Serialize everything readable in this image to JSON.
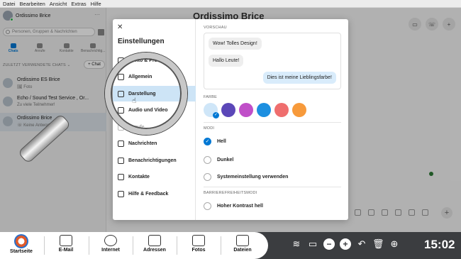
{
  "menubar": [
    "Datei",
    "Bearbeiten",
    "Ansicht",
    "Extras",
    "Hilfe"
  ],
  "sidebar": {
    "profile_name": "Ordissimo Brice",
    "search_placeholder": "Personen, Gruppen & Nachrichten",
    "tabs": [
      "Chats",
      "Anrufe",
      "Kontakte",
      "Benachrichtig..."
    ],
    "recent_label": "ZULETZT VERWENDETE CHATS ⌄",
    "new_chat": "+ Chat",
    "chats": [
      {
        "name": "Ordissimo ES Brice",
        "sub": "🖼 Foto"
      },
      {
        "name": "Echo / Sound Test Service , Or...",
        "sub": "Zu viele Teilnehmer!"
      },
      {
        "name": "Ordissimo Brice",
        "sub": "☏ Keine Antwort"
      }
    ]
  },
  "main": {
    "title": "Ordissimo Brice"
  },
  "dialog": {
    "title": "Einstellungen",
    "menu": [
      {
        "label": "Konto & Profil",
        "active": false,
        "dim": false
      },
      {
        "label": "Allgemein",
        "active": false,
        "dim": false
      },
      {
        "label": "Darstellung",
        "active": true,
        "dim": false
      },
      {
        "label": "Audio und Video",
        "active": false,
        "dim": false
      },
      {
        "label": "Anrufe",
        "active": false,
        "dim": true
      },
      {
        "label": "Nachrichten",
        "active": false,
        "dim": false
      },
      {
        "label": "Benachrichtigungen",
        "active": false,
        "dim": false
      },
      {
        "label": "Kontakte",
        "active": false,
        "dim": false
      },
      {
        "label": "Hilfe & Feedback",
        "active": false,
        "dim": false
      }
    ],
    "preview_label": "VORSCHAU",
    "bubbles": {
      "b1": "Wow! Tolles Design!",
      "b2": "Hallo Leute!",
      "b3": "Dies ist meine Lieblingsfarbe!"
    },
    "color_label": "FARBE",
    "colors": [
      "#cfe6f8",
      "#5b47b8",
      "#c04fc8",
      "#1d8fe0",
      "#ef6e6e",
      "#f79a3b"
    ],
    "selected_color_index": 0,
    "mode_label": "MODI",
    "modes": [
      {
        "label": "Hell",
        "checked": true
      },
      {
        "label": "Dunkel",
        "checked": false
      },
      {
        "label": "Systemeinstellung verwenden",
        "checked": false
      }
    ],
    "access_label": "BARRIEREFREIHEITSMODI",
    "access_modes": [
      {
        "label": "Hoher Kontrast hell",
        "checked": false
      }
    ]
  },
  "taskbar": {
    "items": [
      "Startseite",
      "E-Mail",
      "Internet",
      "Adressen",
      "Fotos",
      "Dateien"
    ],
    "clock": "15:02"
  }
}
